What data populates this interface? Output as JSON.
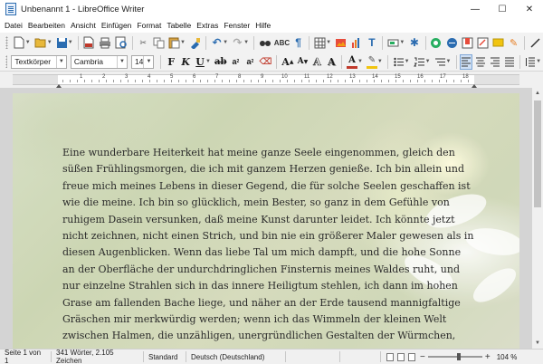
{
  "window": {
    "title": "Unbenannt 1 - LibreOffice Writer",
    "minimize": "—",
    "maximize": "☐",
    "close": "✕"
  },
  "menu": [
    "Datei",
    "Bearbeiten",
    "Ansicht",
    "Einfügen",
    "Format",
    "Tabelle",
    "Extras",
    "Fenster",
    "Hilfe"
  ],
  "formatting": {
    "style": "Textkörper",
    "font": "Cambria",
    "size": "14"
  },
  "ruler": {
    "numbers": [
      "1",
      "2",
      "3",
      "4",
      "5",
      "6",
      "7",
      "8",
      "9",
      "10",
      "11",
      "12",
      "13",
      "14",
      "15",
      "16",
      "17",
      "18"
    ]
  },
  "document": {
    "text": "Eine wunderbare Heiterkeit hat meine ganze Seele eingenommen, gleich den süßen Frühlingsmorgen, die ich mit ganzem Herzen genieße. Ich bin allein und freue mich meines Lebens in dieser Gegend, die für solche Seelen geschaffen ist wie die meine. Ich bin so glücklich, mein Bester, so ganz in dem Gefühle von ruhigem Dasein versunken, daß meine Kunst darunter leidet. Ich könnte jetzt nicht zeichnen, nicht einen Strich, und bin nie ein größerer Maler gewesen als in diesen Augenblicken. Wenn das liebe Tal um mich dampft, und die hohe Sonne an der Oberfläche der undurchdringlichen Finsternis meines Waldes ruht, und nur einzelne Strahlen sich in das innere Heiligtum stehlen, ich dann im hohen Grase am fallenden Bache liege, und näher an der Erde tausend mannigfaltige Gräschen mir merkwürdig werden; wenn ich das Wimmeln der kleinen Welt zwischen Halmen, die unzähligen, unergründlichen Gestalten der Würmchen,"
  },
  "status": {
    "page": "Seite 1 von 1",
    "words": "341 Wörter, 2.105 Zeichen",
    "page_style": "Standard",
    "language": "Deutsch (Deutschland)",
    "zoom_level": 104,
    "zoom": "104 %"
  },
  "colors": {
    "accent": "#2b6cb0",
    "font_color": "#c0392b",
    "highlight": "#f1c40f"
  }
}
